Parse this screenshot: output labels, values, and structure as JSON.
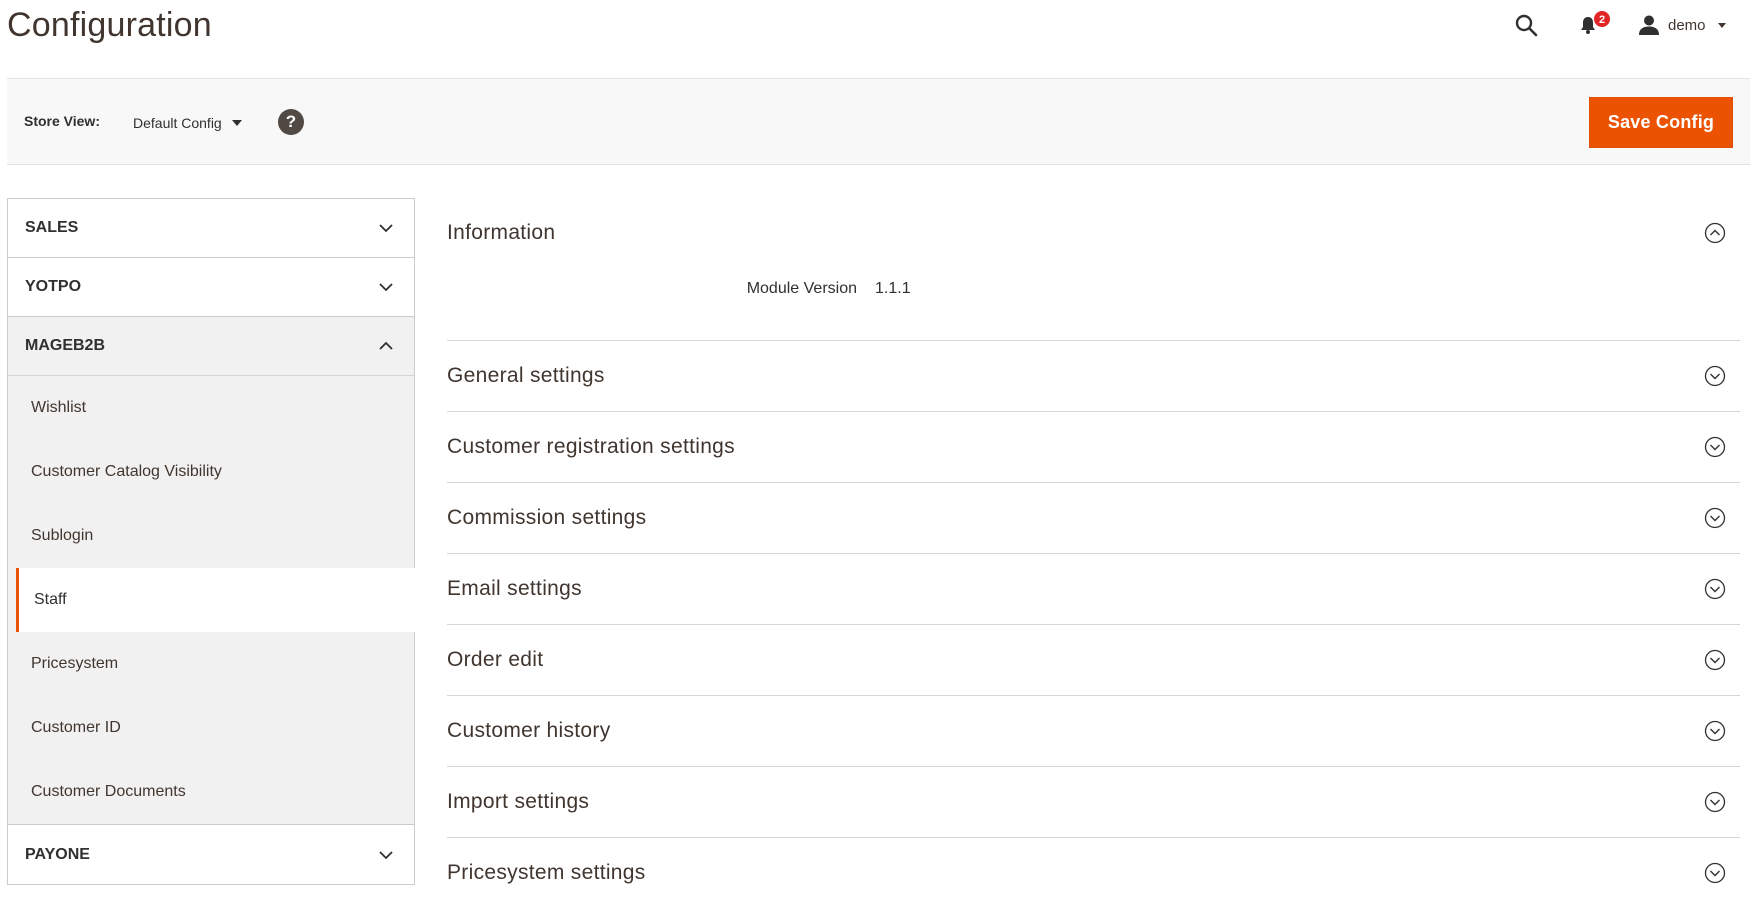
{
  "header": {
    "title": "Configuration",
    "notifications_count": "2",
    "user_name": "demo"
  },
  "store_bar": {
    "label": "Store View:",
    "selected": "Default Config",
    "help": "?",
    "save_label": "Save Config"
  },
  "sidebar": {
    "tabs": [
      {
        "label": "SALES",
        "open": false
      },
      {
        "label": "YOTPO",
        "open": false
      },
      {
        "label": "MAGEB2B",
        "open": true
      },
      {
        "label": "PAYONE",
        "open": false
      }
    ],
    "mageb2b_items": [
      {
        "label": "Wishlist",
        "active": false
      },
      {
        "label": "Customer Catalog Visibility",
        "active": false
      },
      {
        "label": "Sublogin",
        "active": false
      },
      {
        "label": "Staff",
        "active": true
      },
      {
        "label": "Pricesystem",
        "active": false
      },
      {
        "label": "Customer ID",
        "active": false
      },
      {
        "label": "Customer Documents",
        "active": false
      }
    ]
  },
  "main": {
    "information": {
      "title": "Information",
      "field_label": "Module Version",
      "field_value": "1.1.1"
    },
    "sections": [
      "General settings",
      "Customer registration settings",
      "Commission settings",
      "Email settings",
      "Order edit",
      "Customer history",
      "Import settings",
      "Pricesystem settings"
    ]
  },
  "colors": {
    "accent": "#eb5202",
    "badge": "#e22626",
    "text": "#41362f"
  }
}
